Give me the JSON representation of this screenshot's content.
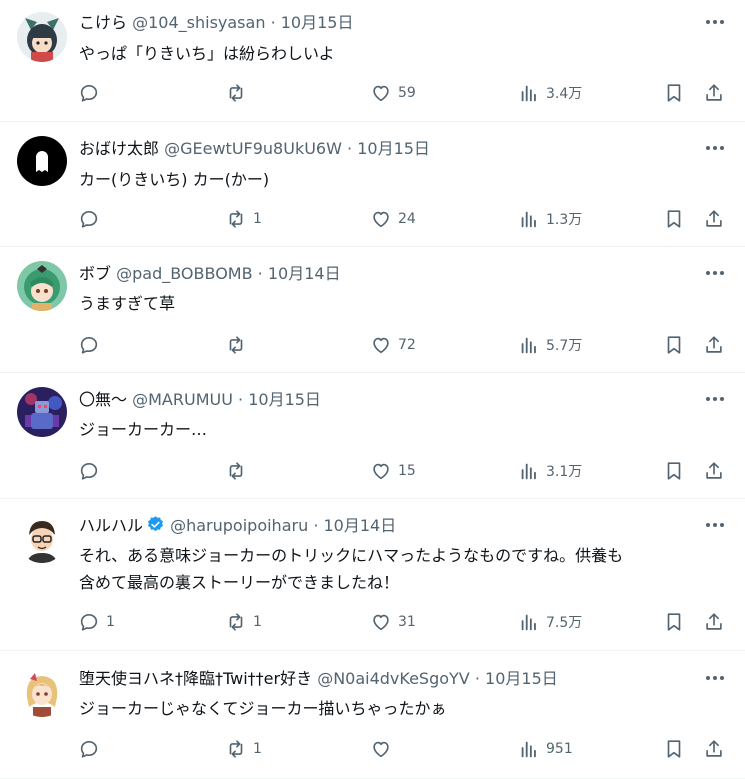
{
  "tweets": [
    {
      "name": "こけら",
      "verified": false,
      "handle": "@104_shisyasan",
      "sep": "·",
      "date": "10月15日",
      "text": "やっぱ「りきいち」は紛らわしいよ",
      "replies": "",
      "retweets": "",
      "likes": "59",
      "views": "3.4万",
      "avatar_icon": "anime-character-avatar"
    },
    {
      "name": "おばけ太郎",
      "verified": false,
      "handle": "@GEewtUF9u8UkU6W",
      "sep": "·",
      "date": "10月15日",
      "text": "カー(りきいち) カー(かー)",
      "replies": "",
      "retweets": "1",
      "likes": "24",
      "views": "1.3万",
      "avatar_icon": "ghost-avatar"
    },
    {
      "name": "ボブ",
      "verified": false,
      "handle": "@pad_BOBBOMB",
      "sep": "·",
      "date": "10月14日",
      "text": "うますぎて草",
      "replies": "",
      "retweets": "",
      "likes": "72",
      "views": "5.7万",
      "avatar_icon": "green-hair-character-avatar"
    },
    {
      "name": "〇無～",
      "verified": false,
      "handle": "@MARUMUU",
      "sep": "·",
      "date": "10月15日",
      "text": "ジョーカーカー…",
      "replies": "",
      "retweets": "",
      "likes": "15",
      "views": "3.1万",
      "avatar_icon": "robot-avatar"
    },
    {
      "name": "ハルハル",
      "verified": true,
      "handle": "@harupoipoiharu",
      "sep": "·",
      "date": "10月14日",
      "text": "それ、ある意味ジョーカーのトリックにハマったようなものですね。供養も\n含めて最高の裏ストーリーができましたね！",
      "replies": "1",
      "retweets": "1",
      "likes": "31",
      "views": "7.5万",
      "avatar_icon": "glasses-boy-avatar"
    },
    {
      "name": "堕天使ヨハネ†降臨†Twi††er好き",
      "verified": false,
      "handle": "@N0ai4dvKeSgoYV",
      "sep": "·",
      "date": "10月15日",
      "text": "ジョーカーじゃなくてジョーカー描いちゃったかぁ",
      "replies": "",
      "retweets": "1",
      "likes": "",
      "views": "951",
      "avatar_icon": "blonde-girl-avatar"
    }
  ],
  "colors": {
    "text": "#0f1419",
    "secondary": "#536471",
    "border": "#eff3f4",
    "verified": "#1d9bf0"
  }
}
